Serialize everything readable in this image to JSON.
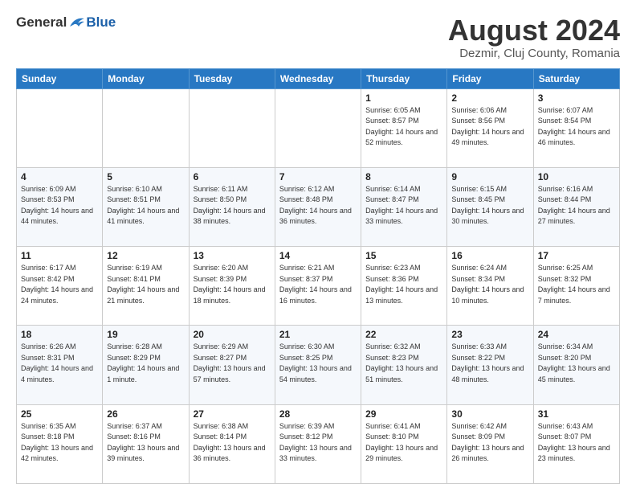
{
  "logo": {
    "general": "General",
    "blue": "Blue"
  },
  "title": {
    "month_year": "August 2024",
    "location": "Dezmir, Cluj County, Romania"
  },
  "weekdays": [
    "Sunday",
    "Monday",
    "Tuesday",
    "Wednesday",
    "Thursday",
    "Friday",
    "Saturday"
  ],
  "weeks": [
    [
      {
        "day": "",
        "sunrise": "",
        "sunset": "",
        "daylight": ""
      },
      {
        "day": "",
        "sunrise": "",
        "sunset": "",
        "daylight": ""
      },
      {
        "day": "",
        "sunrise": "",
        "sunset": "",
        "daylight": ""
      },
      {
        "day": "",
        "sunrise": "",
        "sunset": "",
        "daylight": ""
      },
      {
        "day": "1",
        "sunrise": "Sunrise: 6:05 AM",
        "sunset": "Sunset: 8:57 PM",
        "daylight": "Daylight: 14 hours and 52 minutes."
      },
      {
        "day": "2",
        "sunrise": "Sunrise: 6:06 AM",
        "sunset": "Sunset: 8:56 PM",
        "daylight": "Daylight: 14 hours and 49 minutes."
      },
      {
        "day": "3",
        "sunrise": "Sunrise: 6:07 AM",
        "sunset": "Sunset: 8:54 PM",
        "daylight": "Daylight: 14 hours and 46 minutes."
      }
    ],
    [
      {
        "day": "4",
        "sunrise": "Sunrise: 6:09 AM",
        "sunset": "Sunset: 8:53 PM",
        "daylight": "Daylight: 14 hours and 44 minutes."
      },
      {
        "day": "5",
        "sunrise": "Sunrise: 6:10 AM",
        "sunset": "Sunset: 8:51 PM",
        "daylight": "Daylight: 14 hours and 41 minutes."
      },
      {
        "day": "6",
        "sunrise": "Sunrise: 6:11 AM",
        "sunset": "Sunset: 8:50 PM",
        "daylight": "Daylight: 14 hours and 38 minutes."
      },
      {
        "day": "7",
        "sunrise": "Sunrise: 6:12 AM",
        "sunset": "Sunset: 8:48 PM",
        "daylight": "Daylight: 14 hours and 36 minutes."
      },
      {
        "day": "8",
        "sunrise": "Sunrise: 6:14 AM",
        "sunset": "Sunset: 8:47 PM",
        "daylight": "Daylight: 14 hours and 33 minutes."
      },
      {
        "day": "9",
        "sunrise": "Sunrise: 6:15 AM",
        "sunset": "Sunset: 8:45 PM",
        "daylight": "Daylight: 14 hours and 30 minutes."
      },
      {
        "day": "10",
        "sunrise": "Sunrise: 6:16 AM",
        "sunset": "Sunset: 8:44 PM",
        "daylight": "Daylight: 14 hours and 27 minutes."
      }
    ],
    [
      {
        "day": "11",
        "sunrise": "Sunrise: 6:17 AM",
        "sunset": "Sunset: 8:42 PM",
        "daylight": "Daylight: 14 hours and 24 minutes."
      },
      {
        "day": "12",
        "sunrise": "Sunrise: 6:19 AM",
        "sunset": "Sunset: 8:41 PM",
        "daylight": "Daylight: 14 hours and 21 minutes."
      },
      {
        "day": "13",
        "sunrise": "Sunrise: 6:20 AM",
        "sunset": "Sunset: 8:39 PM",
        "daylight": "Daylight: 14 hours and 18 minutes."
      },
      {
        "day": "14",
        "sunrise": "Sunrise: 6:21 AM",
        "sunset": "Sunset: 8:37 PM",
        "daylight": "Daylight: 14 hours and 16 minutes."
      },
      {
        "day": "15",
        "sunrise": "Sunrise: 6:23 AM",
        "sunset": "Sunset: 8:36 PM",
        "daylight": "Daylight: 14 hours and 13 minutes."
      },
      {
        "day": "16",
        "sunrise": "Sunrise: 6:24 AM",
        "sunset": "Sunset: 8:34 PM",
        "daylight": "Daylight: 14 hours and 10 minutes."
      },
      {
        "day": "17",
        "sunrise": "Sunrise: 6:25 AM",
        "sunset": "Sunset: 8:32 PM",
        "daylight": "Daylight: 14 hours and 7 minutes."
      }
    ],
    [
      {
        "day": "18",
        "sunrise": "Sunrise: 6:26 AM",
        "sunset": "Sunset: 8:31 PM",
        "daylight": "Daylight: 14 hours and 4 minutes."
      },
      {
        "day": "19",
        "sunrise": "Sunrise: 6:28 AM",
        "sunset": "Sunset: 8:29 PM",
        "daylight": "Daylight: 14 hours and 1 minute."
      },
      {
        "day": "20",
        "sunrise": "Sunrise: 6:29 AM",
        "sunset": "Sunset: 8:27 PM",
        "daylight": "Daylight: 13 hours and 57 minutes."
      },
      {
        "day": "21",
        "sunrise": "Sunrise: 6:30 AM",
        "sunset": "Sunset: 8:25 PM",
        "daylight": "Daylight: 13 hours and 54 minutes."
      },
      {
        "day": "22",
        "sunrise": "Sunrise: 6:32 AM",
        "sunset": "Sunset: 8:23 PM",
        "daylight": "Daylight: 13 hours and 51 minutes."
      },
      {
        "day": "23",
        "sunrise": "Sunrise: 6:33 AM",
        "sunset": "Sunset: 8:22 PM",
        "daylight": "Daylight: 13 hours and 48 minutes."
      },
      {
        "day": "24",
        "sunrise": "Sunrise: 6:34 AM",
        "sunset": "Sunset: 8:20 PM",
        "daylight": "Daylight: 13 hours and 45 minutes."
      }
    ],
    [
      {
        "day": "25",
        "sunrise": "Sunrise: 6:35 AM",
        "sunset": "Sunset: 8:18 PM",
        "daylight": "Daylight: 13 hours and 42 minutes."
      },
      {
        "day": "26",
        "sunrise": "Sunrise: 6:37 AM",
        "sunset": "Sunset: 8:16 PM",
        "daylight": "Daylight: 13 hours and 39 minutes."
      },
      {
        "day": "27",
        "sunrise": "Sunrise: 6:38 AM",
        "sunset": "Sunset: 8:14 PM",
        "daylight": "Daylight: 13 hours and 36 minutes."
      },
      {
        "day": "28",
        "sunrise": "Sunrise: 6:39 AM",
        "sunset": "Sunset: 8:12 PM",
        "daylight": "Daylight: 13 hours and 33 minutes."
      },
      {
        "day": "29",
        "sunrise": "Sunrise: 6:41 AM",
        "sunset": "Sunset: 8:10 PM",
        "daylight": "Daylight: 13 hours and 29 minutes."
      },
      {
        "day": "30",
        "sunrise": "Sunrise: 6:42 AM",
        "sunset": "Sunset: 8:09 PM",
        "daylight": "Daylight: 13 hours and 26 minutes."
      },
      {
        "day": "31",
        "sunrise": "Sunrise: 6:43 AM",
        "sunset": "Sunset: 8:07 PM",
        "daylight": "Daylight: 13 hours and 23 minutes."
      }
    ]
  ]
}
